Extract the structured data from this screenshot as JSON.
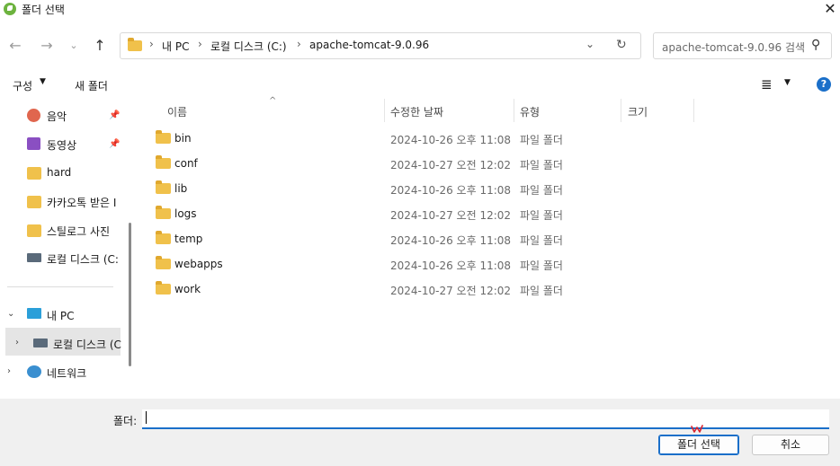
{
  "window": {
    "title": "폴더 선택"
  },
  "nav": {
    "breadcrumbs": [
      "내 PC",
      "로컬 디스크 (C:)",
      "apache-tomcat-9.0.96"
    ],
    "search_placeholder": "apache-tomcat-9.0.96 검색"
  },
  "toolbar": {
    "organize": "구성",
    "new_folder": "새 폴더"
  },
  "sidebar": {
    "quick": [
      {
        "label": "음악",
        "icon": "music-icon",
        "pinned": true
      },
      {
        "label": "동영상",
        "icon": "video-icon",
        "pinned": true
      },
      {
        "label": "hard",
        "icon": "folder-icon",
        "pinned": false
      },
      {
        "label": "카카오톡 받은 I",
        "icon": "folder-icon",
        "pinned": false
      },
      {
        "label": "스틸로그 사진",
        "icon": "folder-icon",
        "pinned": false
      },
      {
        "label": "로컬 디스크 (C:",
        "icon": "drive-icon",
        "pinned": false
      }
    ],
    "pc": "내 PC",
    "local_disk": "로컬 디스크 (C",
    "network": "네트워크"
  },
  "columns": [
    "이름",
    "수정한 날짜",
    "유형",
    "크기"
  ],
  "files": [
    {
      "name": "bin",
      "date": "2024-10-26 오후 11:08",
      "type": "파일 폴더"
    },
    {
      "name": "conf",
      "date": "2024-10-27 오전 12:02",
      "type": "파일 폴더"
    },
    {
      "name": "lib",
      "date": "2024-10-26 오후 11:08",
      "type": "파일 폴더"
    },
    {
      "name": "logs",
      "date": "2024-10-27 오전 12:02",
      "type": "파일 폴더"
    },
    {
      "name": "temp",
      "date": "2024-10-26 오후 11:08",
      "type": "파일 폴더"
    },
    {
      "name": "webapps",
      "date": "2024-10-26 오후 11:08",
      "type": "파일 폴더"
    },
    {
      "name": "work",
      "date": "2024-10-27 오전 12:02",
      "type": "파일 폴더"
    }
  ],
  "footer": {
    "folder_label": "폴더:",
    "folder_value": "",
    "select_button": "폴더 선택",
    "cancel_button": "취소"
  },
  "colors": {
    "accent": "#1a6fc9",
    "folder": "#f0c14b",
    "selection": "#e5e5e5"
  }
}
